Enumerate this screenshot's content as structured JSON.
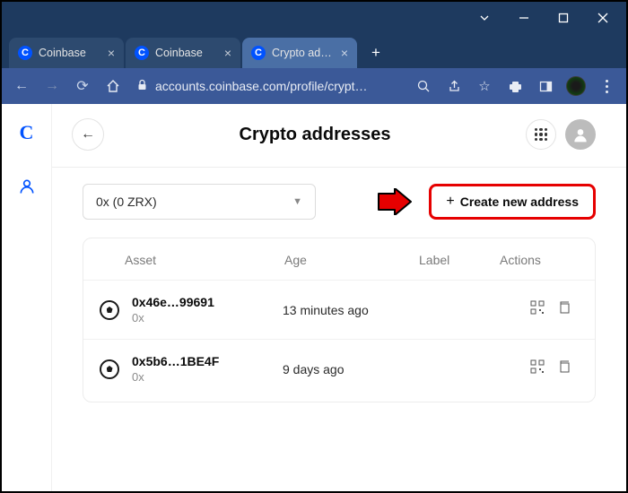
{
  "window": {
    "tabs": [
      {
        "title": "Coinbase",
        "favicon": "C",
        "active": false
      },
      {
        "title": "Coinbase",
        "favicon": "C",
        "active": false
      },
      {
        "title": "Crypto add…",
        "favicon": "C",
        "active": true
      }
    ]
  },
  "addressbar": {
    "url": "accounts.coinbase.com/profile/crypt…"
  },
  "page": {
    "title": "Crypto addresses",
    "asset_selector": {
      "selected": "0x (0 ZRX)"
    },
    "create_button_label": "Create new address",
    "table": {
      "headers": {
        "asset": "Asset",
        "age": "Age",
        "label": "Label",
        "actions": "Actions"
      },
      "rows": [
        {
          "address": "0x46e…99691",
          "symbol": "0x",
          "age": "13 minutes ago"
        },
        {
          "address": "0x5b6…1BE4F",
          "symbol": "0x",
          "age": "9 days ago"
        }
      ]
    }
  }
}
